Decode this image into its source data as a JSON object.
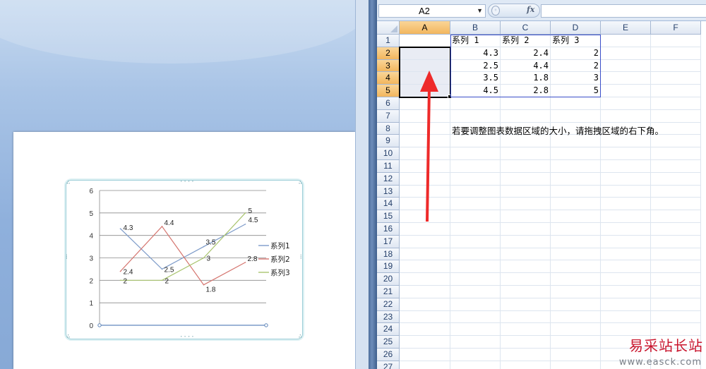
{
  "name_box": {
    "value": "A2"
  },
  "formula_bar": {
    "fx_label": "fx",
    "formula": ""
  },
  "columns": [
    "A",
    "B",
    "C",
    "D",
    "E",
    "F"
  ],
  "rows": [
    "1",
    "2",
    "3",
    "4",
    "5",
    "6",
    "7",
    "8",
    "9",
    "10",
    "11",
    "12",
    "13",
    "14",
    "15",
    "16",
    "17",
    "18",
    "19",
    "20",
    "21",
    "22",
    "23",
    "24",
    "25",
    "26",
    "27"
  ],
  "selected": {
    "column": "A",
    "rows": [
      "2",
      "3",
      "4",
      "5"
    ]
  },
  "headers_row1": [
    "系列 1",
    "系列 2",
    "系列 3"
  ],
  "table": [
    [
      "4.3",
      "2.4",
      "2"
    ],
    [
      "2.5",
      "4.4",
      "2"
    ],
    [
      "3.5",
      "1.8",
      "3"
    ],
    [
      "4.5",
      "2.8",
      "5"
    ]
  ],
  "note": "若要调整图表数据区域的大小，请拖拽区域的右下角。",
  "chart_data": {
    "type": "line",
    "categories": [
      "",
      "",
      "",
      ""
    ],
    "ylim": [
      0,
      6
    ],
    "yticks": [
      "0",
      "1",
      "2",
      "3",
      "4",
      "5",
      "6"
    ],
    "grid": true,
    "legend_position": "right",
    "series": [
      {
        "name": "系列1",
        "color": "#7d9bc9",
        "values": [
          4.3,
          2.5,
          3.5,
          4.5
        ],
        "labels": [
          "4.3",
          "2.5",
          "3.5",
          "4.5"
        ]
      },
      {
        "name": "系列2",
        "color": "#d5756f",
        "values": [
          2.4,
          4.4,
          1.8,
          2.8
        ],
        "labels": [
          "2.4",
          "4.4",
          "1.8",
          "2.8"
        ]
      },
      {
        "name": "系列3",
        "color": "#a9c46e",
        "values": [
          2,
          2,
          3,
          5
        ],
        "labels": [
          "2",
          "2",
          "3",
          "5"
        ]
      }
    ]
  },
  "colors": {
    "selection_outline": "#000000",
    "data_range_outline": "#3a4ec9",
    "arrow": "#ee2a2a",
    "header_selected": "#f6c77a"
  },
  "watermark": {
    "text": "易采站长站",
    "url": "www.easck.com"
  }
}
